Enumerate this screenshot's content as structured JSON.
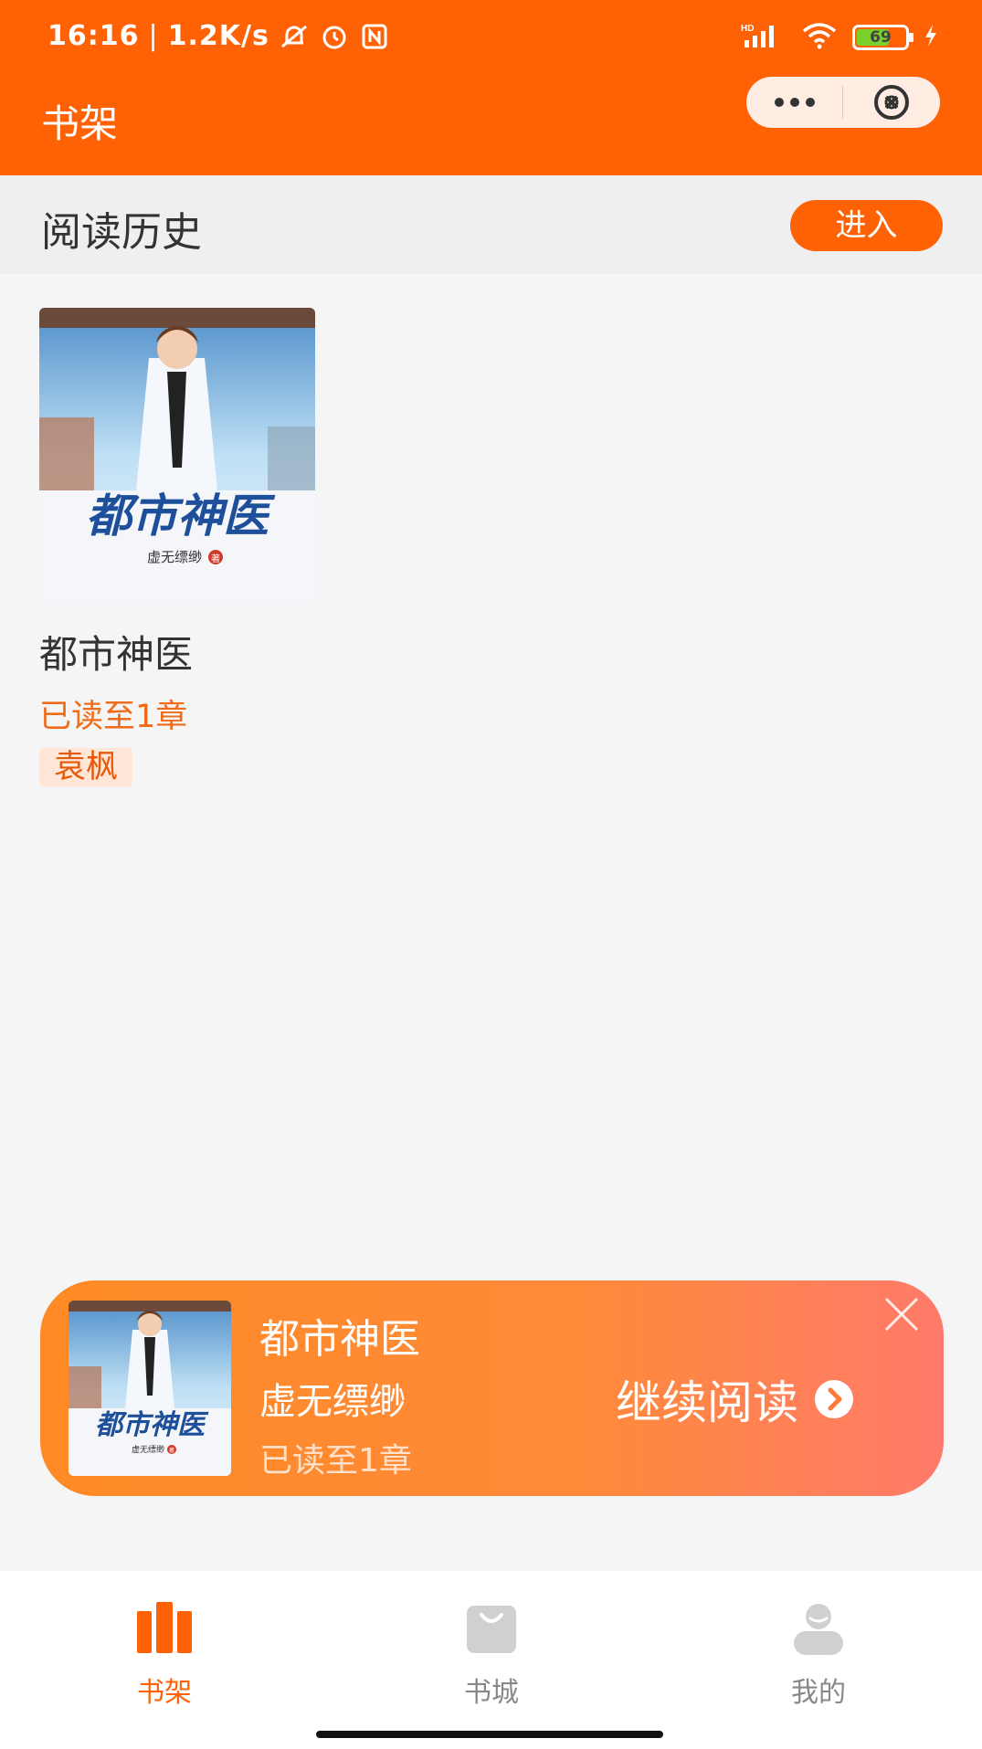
{
  "status_bar": {
    "time": "16:16",
    "speed": "1.2K/s",
    "network": "HD",
    "battery": "69",
    "battery_level": 0.69
  },
  "header": {
    "title": "书架",
    "more_icon": "more-dots-icon",
    "close_icon": "close-circle-icon"
  },
  "section": {
    "title": "阅读历史",
    "enter_label": "进入"
  },
  "book": {
    "cover_title": "都市神医",
    "cover_author": "虚无缥缈",
    "cover_seal": "著",
    "title": "都市神医",
    "progress": "已读至1章",
    "tag": "袁枫"
  },
  "banner": {
    "title": "都市神医",
    "author": "虚无缥缈",
    "progress": "已读至1章",
    "continue_label": "继续阅读"
  },
  "nav": {
    "items": [
      {
        "label": "书架",
        "icon": "bookshelf-icon",
        "active": true
      },
      {
        "label": "书城",
        "icon": "shopping-bag-icon",
        "active": false
      },
      {
        "label": "我的",
        "icon": "user-icon",
        "active": false
      }
    ]
  },
  "colors": {
    "primary": "#ff6204",
    "banner_start": "#ff8a25",
    "banner_end": "#ff7a6a",
    "inactive": "#cccccc"
  }
}
